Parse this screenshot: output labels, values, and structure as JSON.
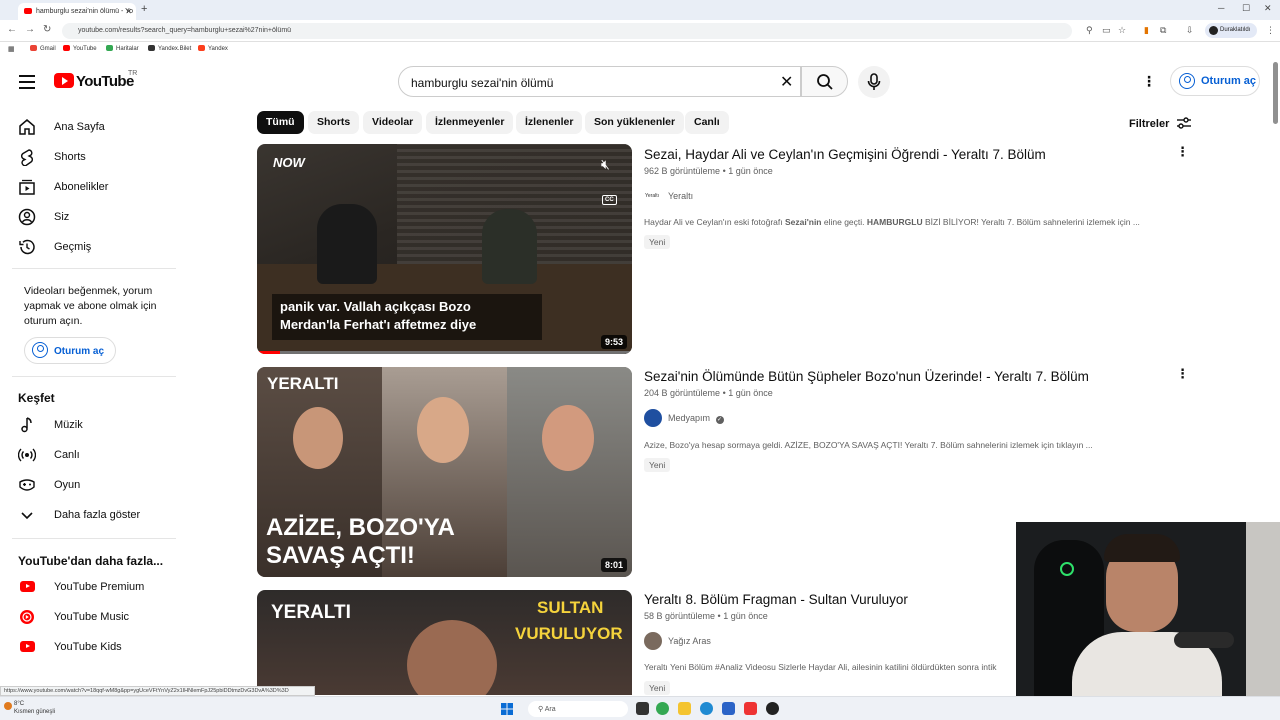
{
  "browser": {
    "tab_title": "hamburglu sezai'nin ölümü - Yo",
    "url": "youtube.com/results?search_query=hamburglu+sezai%27nin+ölümü",
    "profile_label": "Duraklatıldı",
    "bookmarks": [
      {
        "label": "Gmail",
        "color": "#ea4335"
      },
      {
        "label": "YouTube",
        "color": "#ff0000"
      },
      {
        "label": "Haritalar",
        "color": "#34a853"
      },
      {
        "label": "Yandex.Bilet",
        "color": "#333333"
      },
      {
        "label": "Yandex",
        "color": "#fc3f1d"
      }
    ],
    "status_url": "https://www.youtube.com/watch?v=18qqf-wM8g&pp=ygUceVFtYnVyZ2x1IHNlemFpJ25pbiDDtmzDvG3DvA%3D%3D"
  },
  "header": {
    "logo_text": "YouTube",
    "logo_region": "TR",
    "search_query": "hamburglu sezai'nin ölümü",
    "signin_label": "Oturum aç"
  },
  "sidebar": {
    "main_items": [
      {
        "label": "Ana Sayfa",
        "icon": "home-icon"
      },
      {
        "label": "Shorts",
        "icon": "shorts-icon"
      },
      {
        "label": "Abonelikler",
        "icon": "subscriptions-icon"
      },
      {
        "label": "Siz",
        "icon": "you-icon"
      },
      {
        "label": "Geçmiş",
        "icon": "history-icon"
      }
    ],
    "signin_message": "Videoları beğenmek, yorum yapmak ve abone olmak için oturum açın.",
    "signin_label": "Oturum aç",
    "explore_heading": "Keşfet",
    "explore_items": [
      {
        "label": "Müzik",
        "icon": "music-icon"
      },
      {
        "label": "Canlı",
        "icon": "live-icon"
      },
      {
        "label": "Oyun",
        "icon": "gaming-icon"
      },
      {
        "label": "Daha fazla göster",
        "icon": "chevron-down-icon"
      }
    ],
    "more_heading": "YouTube'dan daha fazla...",
    "more_items": [
      {
        "label": "YouTube Premium",
        "icon": "youtube-premium-icon"
      },
      {
        "label": "YouTube Music",
        "icon": "youtube-music-icon"
      },
      {
        "label": "YouTube Kids",
        "icon": "youtube-kids-icon"
      }
    ]
  },
  "chips": [
    "Tümü",
    "Shorts",
    "Videolar",
    "İzlenmeyenler",
    "İzlenenler",
    "Son yüklenenler",
    "Canlı"
  ],
  "filters_label": "Filtreler",
  "results": [
    {
      "title": "Sezai, Haydar Ali ve Ceylan'ın Geçmişini Öğrendi - Yeraltı 7. Bölüm",
      "views": "962 B görüntüleme",
      "age": "1 gün önce",
      "channel": "Yeraltı",
      "verified": false,
      "description_parts": [
        "Haydar Ali ve Ceylan'ın eski fotoğrafı ",
        "Sezai'nin",
        " eline geçti. ",
        "HAMBURGLU",
        " BİZİ BİLİYOR! Yeraltı 7. Bölüm sahnelerini izlemek için ..."
      ],
      "badge": "Yeni",
      "duration": "9:53",
      "thumb_caption_1": "panik var. Vallah açıkçası Bozo",
      "thumb_caption_2": "Merdan'la Ferhat'ı affetmez diye",
      "thumb_logo": "NOW",
      "thumb_cc": "CC"
    },
    {
      "title": "Sezai'nin Ölümünde Bütün Şüpheler Bozo'nun Üzerinde! - Yeraltı 7. Bölüm",
      "views": "204 B görüntüleme",
      "age": "1 gün önce",
      "channel": "Medyapım",
      "verified": true,
      "description_parts": [
        "Azize, Bozo'ya hesap sormaya geldi. AZİZE, BOZO'YA SAVAŞ AÇTI! Yeraltı 7. Bölüm sahnelerini izlemek için tıklayın ..."
      ],
      "badge": "Yeni",
      "duration": "8:01",
      "thumb_brand": "YERALTI",
      "thumb_headline_1": "AZİZE, BOZO'YA",
      "thumb_headline_2": "SAVAŞ AÇTI!"
    },
    {
      "title": "Yeraltı 8. Bölüm Fragman - Sultan Vuruluyor",
      "views": "58 B görüntüleme",
      "age": "1 gün önce",
      "channel": "Yağız Aras",
      "verified": false,
      "description_parts": [
        "Yeraltı Yeni Bölüm #Analiz Videosu Sizlerle Haydar Ali, ailesinin katilini öldürdükten sonra intik"
      ],
      "badge": "Yeni",
      "thumb_brand": "YERALTI",
      "thumb_headline_1": "SULTAN",
      "thumb_headline_2": "VURULUYOR"
    }
  ],
  "taskbar": {
    "weather_temp": "8°C",
    "weather_desc": "Kısmen güneşli",
    "search_placeholder": "Ara"
  },
  "colors": {
    "brand_red": "#ff0000",
    "link_blue": "#065fd4",
    "chip_bg": "#f2f2f2"
  }
}
